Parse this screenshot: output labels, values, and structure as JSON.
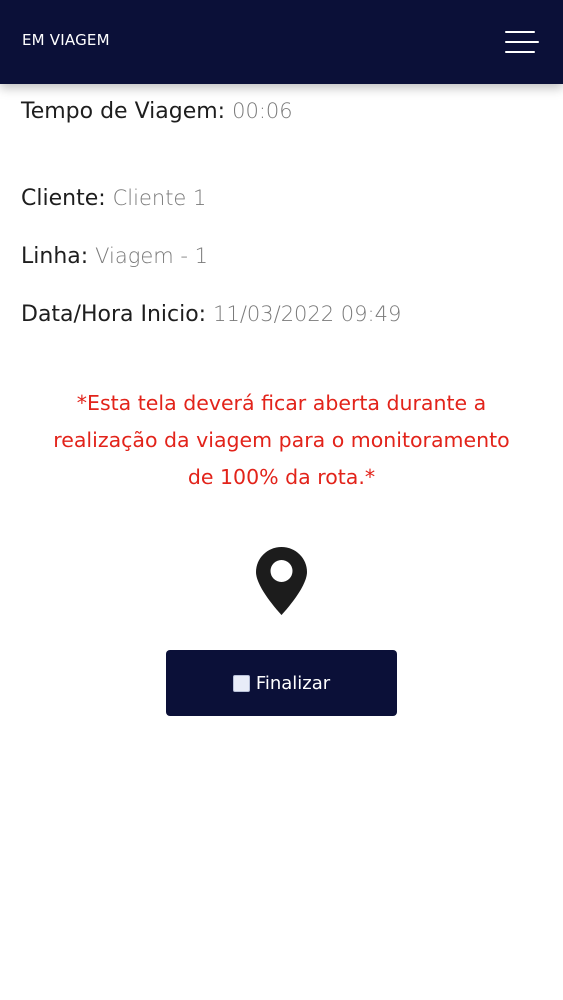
{
  "header": {
    "title": "EM VIAGEM",
    "menu_icon": "hamburger-menu-icon"
  },
  "trip": {
    "tempo_label": "Tempo de Viagem:",
    "tempo_value": "00:06",
    "cliente_label": "Cliente:",
    "cliente_value": "Cliente 1",
    "linha_label": "Linha:",
    "linha_value": "Viagem - 1",
    "inicio_label": "Data/Hora Inicio:",
    "inicio_value": "11/03/2022 09:49"
  },
  "warning": {
    "line1": "*Esta tela deverá ficar aberta durante a",
    "line2": "realização da viagem para o monitoramento",
    "line3": "de 100% da rota.*",
    "color": "#e2231a"
  },
  "location_icon": "map-pin-icon",
  "finish_button": {
    "label": "Finalizar",
    "icon": "stop-square-icon"
  },
  "colors": {
    "header_bg": "#0b1038",
    "button_bg": "#0b1038"
  }
}
